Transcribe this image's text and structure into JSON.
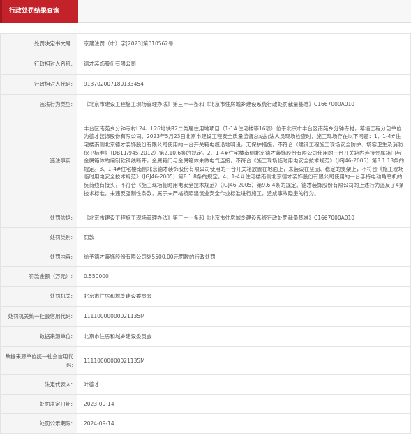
{
  "header": {
    "title": "行政处罚结果查询"
  },
  "rows": [
    {
      "label": "处罚决定书文号:",
      "value": "京建法罚（市）字[2023]第010562号"
    },
    {
      "label": "行政相对人名称:",
      "value": "德才装饰股份有限公司"
    },
    {
      "label": "行政相对人代码:",
      "value": "913702007180133454"
    },
    {
      "label": "违法行为类型:",
      "value": "《北京市建设工程施工现场管理办法》第三十一条和《北京市住房城乡建设系统行政处罚裁量基准》C1667000A010"
    },
    {
      "label": "违法事实:",
      "value": "丰台区南苑乡分钟寺村L24、L26地块R2二类居住用地项目（1-1#住宅楼等16项）位于北京市丰台区南苑乡分钟寺村，幕墙工程分包单位为德才装饰股份有限公司。2023年5月23日北京市建设工程安全质量监督总站执法人员现场检查时，施工现场存在以下问题：1、1-4#住宅楼南侧北京德才装饰股份有限公司使用的一台开关箱电缆沿地明设，无保护措施，不符合《建设工程施工现场安全防护、场容卫生及消防保卫标准》（DB11/945-2012）第2.10.6条的规定。2、1-4#住宅楼南侧北京德才装饰股份有限公司使用的一台开关箱内连接金属箱门与金属箱体的编制软铜线断开，金属箱门与金属箱体未做电气连接，不符合《施工现场临时用电安全技术规范》（JGJ46-2005）第8.1.13条的规定。3、1-4#住宅楼南侧北京德才装饰股份有限公司使用的一台开关箱放置在地面上，未装设在坚固、稳定的支架上，不符合《施工现场临时用电安全技术规范》（JGJ46-2005）第8.1.8条的规定。4、1-4＃住宅楼南侧北京德才装饰股份有限公司使用的一台手持电动角磨机的负荷线有接头，不符合《施工现场临时用电安全技术规范》（JGJ46-2005）第9.6.4条的规定。德才装饰股份有限公司的上述行为违反了4条技术标准，未违反强制性条款，属于未严格按照建筑业安全作业标准进行施工，造成事故隐患的行为。"
    },
    {
      "label": "处罚依据:",
      "value": "《北京市建设工程施工现场管理办法》第三十一条和《北京市住房城乡建设系统行政处罚裁量基准》C1667000A010"
    },
    {
      "label": "处罚类别:",
      "value": "罚款"
    },
    {
      "label": "处罚内容:",
      "value": "给予德才装饰股份有限公司处5500.00元罚款的行政处罚"
    },
    {
      "label": "罚款金额（万元）:",
      "value": "0.550000"
    },
    {
      "label": "处罚机关:",
      "value": "北京市住房和城乡建设委员会"
    },
    {
      "label": "处罚机关统一社会信用代码:",
      "value": "11110000000021135M"
    },
    {
      "label": "数据来源单位:",
      "value": "北京市住房和城乡建设委员会"
    },
    {
      "label": "数据来源单位统一社会信用代码:",
      "value": "11110000000021135M"
    },
    {
      "label": "法定代表人:",
      "value": "叶德才"
    },
    {
      "label": "处罚决定日期:",
      "value": "2023-09-14"
    },
    {
      "label": "处罚公示期限:",
      "value": "2024-09-14"
    }
  ]
}
